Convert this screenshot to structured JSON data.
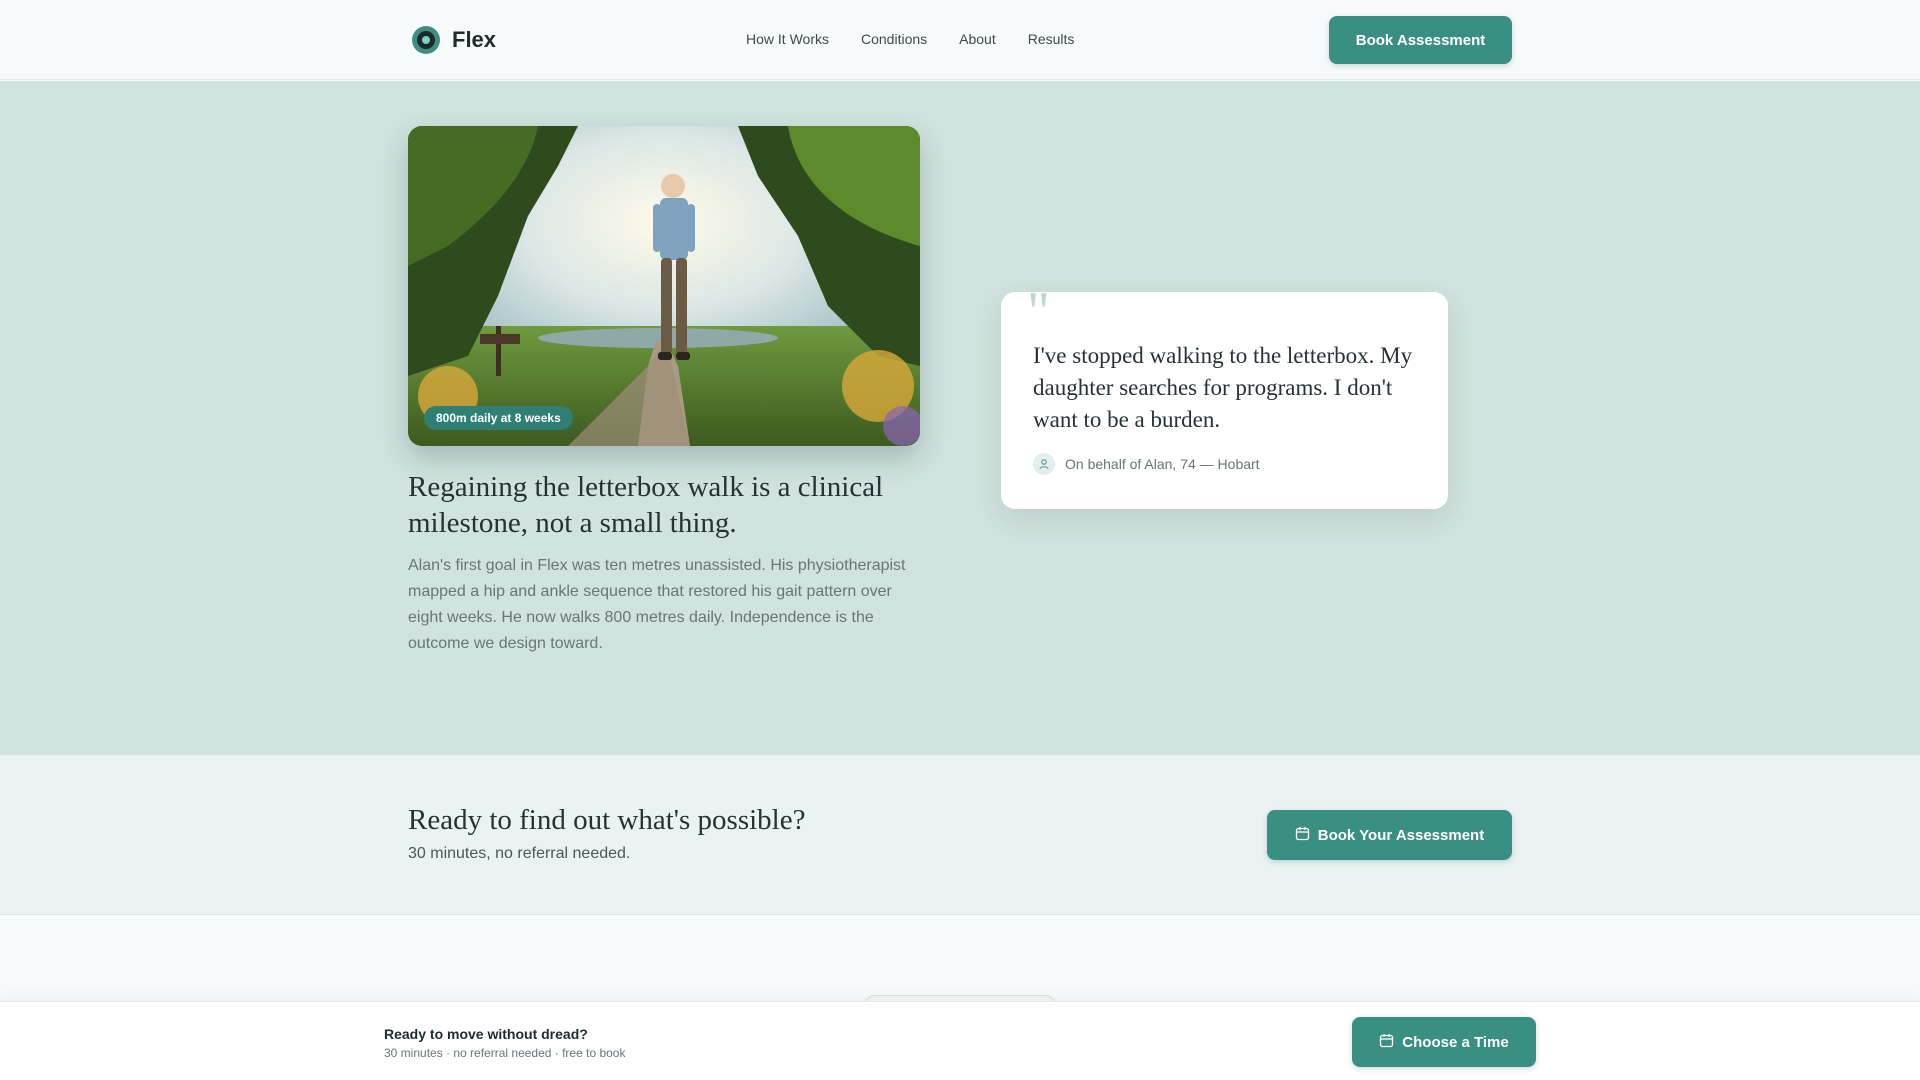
{
  "header": {
    "brand": "Flex",
    "nav": [
      "How It Works",
      "Conditions",
      "About",
      "Results"
    ],
    "cta_label": "Book Assessment"
  },
  "hero": {
    "photo_badge": "800m daily at 8 weeks",
    "story_title": "Regaining the letterbox walk is a clinical milestone, not a small thing.",
    "story_body": "Alan's first goal in Flex was ten metres unassisted. His physiotherapist mapped a hip and ankle sequence that restored his gait pattern over eight weeks. He now walks 800 metres daily. Independence is the outcome we design toward.",
    "quote": {
      "mark": "\"",
      "text": "I've stopped walking to the letterbox. My daughter searches for programs. I don't want to be a burden.",
      "author": "On behalf of Alan, 74 — Hobart"
    }
  },
  "cta_band": {
    "title": "Ready to find out what's possible?",
    "subtitle": "30 minutes, no referral needed.",
    "button_label": "Book Your Assessment"
  },
  "sticky_bar": {
    "title": "Ready to move without dread?",
    "subtitle": "30 minutes · no referral needed · free to book",
    "button_label": "Choose a Time"
  },
  "icons": {
    "logo": "flex-logo-icon",
    "calendar": "calendar-icon",
    "user": "user-icon"
  },
  "colors": {
    "accent": "#3a8f83",
    "hero_bg": "#d1e3de",
    "cta_bg": "#eaf3f1"
  }
}
